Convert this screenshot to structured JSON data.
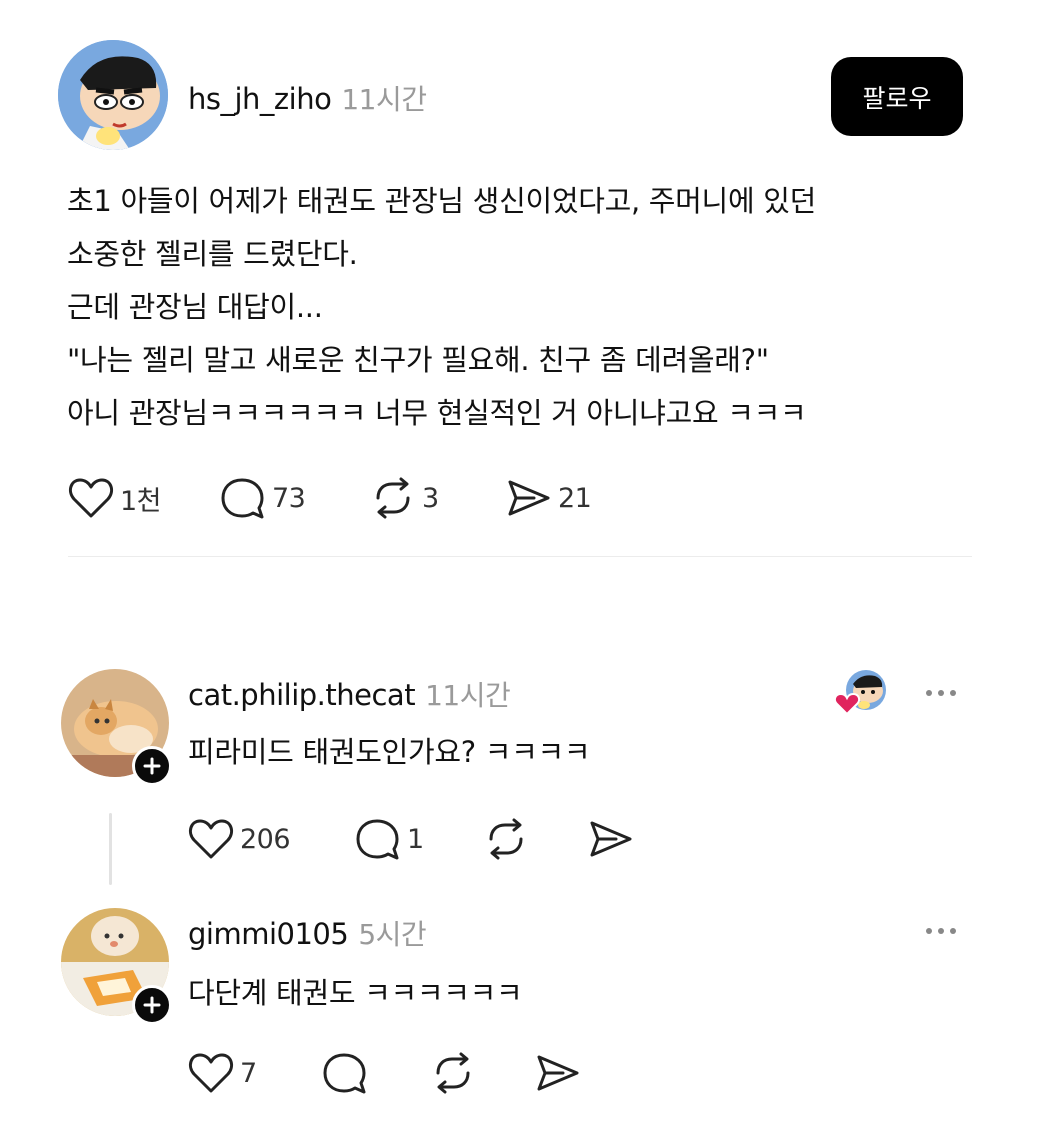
{
  "post": {
    "author": "hs_jh_ziho",
    "time": "11시간",
    "follow_label": "팔로우",
    "lines": [
      "초1 아들이 어제가 태권도 관장님 생신이었다고, 주머니에 있던",
      "소중한 젤리를 드렸단다.",
      "근데 관장님 대답이...",
      "\"나는 젤리 말고 새로운 친구가 필요해. 친구 좀 데려올래?\"",
      "아니 관장님ㅋㅋㅋㅋㅋㅋ 너무 현실적인 거 아니냐고요 ㅋㅋㅋ"
    ],
    "actions": {
      "likes": "1천",
      "comments": "73",
      "reposts": "3",
      "shares": "21"
    }
  },
  "comments": [
    {
      "author": "cat.philip.thecat",
      "time": "11시간",
      "text": "피라미드 태권도인가요? ㅋㅋㅋㅋ",
      "actions": {
        "likes": "206",
        "comments": "1"
      }
    },
    {
      "author": "gimmi0105",
      "time": "5시간",
      "text": "다단계 태권도 ㅋㅋㅋㅋㅋㅋ",
      "actions": {
        "likes": "7"
      }
    }
  ],
  "icons": {
    "heart": "heart-icon",
    "comment": "comment-icon",
    "repost": "repost-icon",
    "share": "share-icon",
    "more": "more-icon",
    "plus": "plus-icon",
    "liked": "liked-heart-icon"
  },
  "colors": {
    "follow_bg": "#000000",
    "liked_heart": "#e0245e",
    "muted": "#9a9a9a"
  }
}
